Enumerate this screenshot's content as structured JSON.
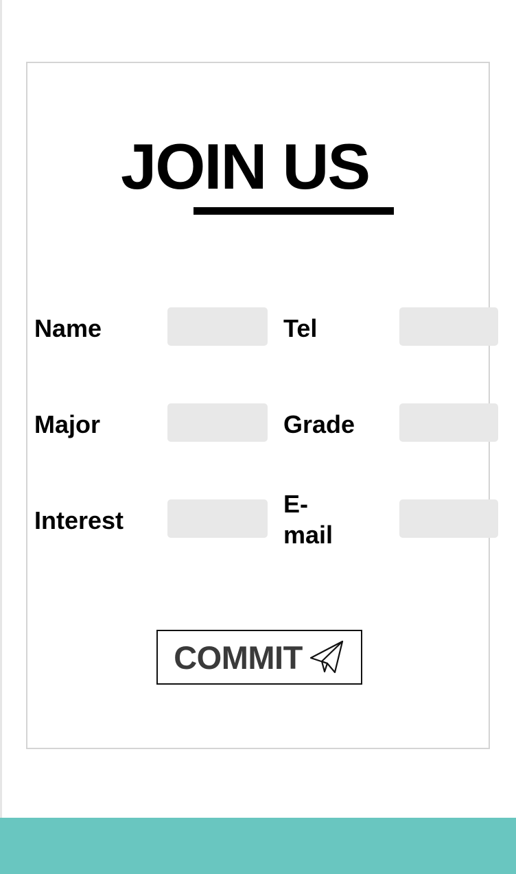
{
  "form": {
    "title": "JOIN US",
    "fields": [
      {
        "label": "Name",
        "value": ""
      },
      {
        "label": "Tel",
        "value": ""
      },
      {
        "label": "Major",
        "value": ""
      },
      {
        "label": "Grade",
        "value": ""
      },
      {
        "label": "Interest",
        "value": ""
      },
      {
        "label": "E-mail",
        "value": ""
      }
    ],
    "submit": {
      "label": "COMMIT",
      "icon": "paper-plane-icon"
    }
  },
  "colors": {
    "footer": "#69c6c0",
    "input_background": "#e8e8e8",
    "card_border": "#d4d4d4",
    "button_text": "#3a3a3a"
  }
}
